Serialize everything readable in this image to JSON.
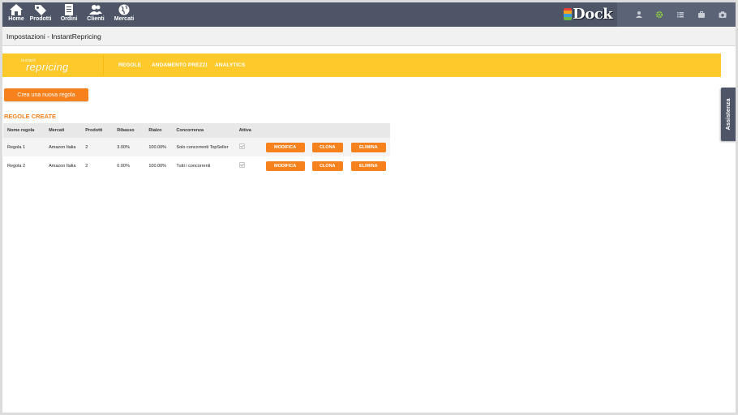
{
  "nav": [
    {
      "label": "Home",
      "icon": "home-icon"
    },
    {
      "label": "Prodotti",
      "icon": "tag-icon"
    },
    {
      "label": "Ordini",
      "icon": "document-icon"
    },
    {
      "label": "Clienti",
      "icon": "users-icon"
    },
    {
      "label": "Mercati",
      "icon": "globe-icon"
    }
  ],
  "brand": {
    "name": "Dock",
    "badge_colors": [
      "#e8403a",
      "#f4a21d",
      "#3a9fdd",
      "#6bb744"
    ]
  },
  "tools": [
    "user-icon",
    "settings-icon",
    "list-icon",
    "briefcase-icon",
    "camera-icon"
  ],
  "breadcrumb": "Impostazioni - InstantRepricing",
  "banner": {
    "logo_small": "instant",
    "logo_main": "repricing",
    "links": [
      "REGOLE",
      "ANDAMENTO PREZZI",
      "ANALYTICS"
    ]
  },
  "assist_label": "Assistenza",
  "create_button": "Crea una nuova regola",
  "section_title": "REGOLE CREATE",
  "table": {
    "headers": [
      "Nome regola",
      "Mercati",
      "Prodotti",
      "Ribasso",
      "Rialzo",
      "Concorrenza",
      "Attiva"
    ],
    "rows": [
      {
        "nome": "Regola 1",
        "mercati": "Amazon Italia",
        "prodotti": "2",
        "ribasso": "3.00%",
        "rialzo": "100.00%",
        "concorrenza": "Solo concorrenti TopSeller",
        "attiva": true
      },
      {
        "nome": "Regola 2",
        "mercati": "Amazon Italia",
        "prodotti": "2",
        "ribasso": "0.00%",
        "rialzo": "100.00%",
        "concorrenza": "Tutti i concorrenti",
        "attiva": true
      }
    ],
    "actions": [
      "MODIFICA",
      "CLONA",
      "ELIMINA"
    ]
  },
  "colors": {
    "accent": "#f7811c",
    "banner": "#fec92b",
    "nav": "#4d5567"
  }
}
